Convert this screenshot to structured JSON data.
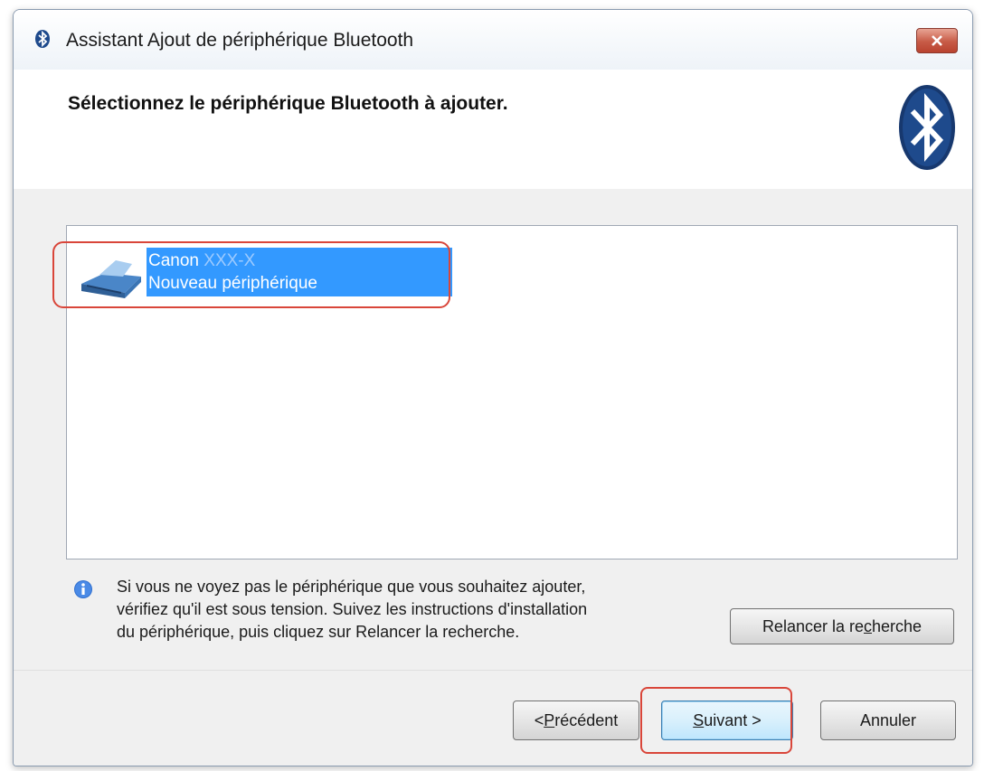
{
  "window": {
    "title": "Assistant Ajout de périphérique Bluetooth",
    "close_icon": "close-icon",
    "title_icon": "bluetooth-icon"
  },
  "header": {
    "title": "Sélectionnez le périphérique Bluetooth à ajouter.",
    "logo": "bluetooth-logo"
  },
  "device_list": {
    "items": [
      {
        "name": "Canon",
        "name_suffix": "XXX-X",
        "status": "Nouveau périphérique",
        "icon": "printer-icon",
        "selected": true
      }
    ]
  },
  "info": {
    "icon": "info-icon",
    "lines": [
      "Si vous ne voyez pas le périphérique que vous souhaitez ajouter,",
      "vérifiez qu'il est sous tension. Suivez les instructions d'installation",
      "du périphérique, puis cliquez sur Relancer la recherche."
    ]
  },
  "buttons": {
    "retry": {
      "pre": "Relancer la re",
      "ul": "c",
      "post": "herche"
    },
    "prev": {
      "pre": "< ",
      "ul": "P",
      "post": "récédent"
    },
    "next": {
      "pre": "",
      "ul": "S",
      "post": "uivant >"
    },
    "cancel": {
      "label": "Annuler"
    }
  },
  "colors": {
    "selection": "#3399ff",
    "annotation": "#d9463a",
    "bluetooth": "#1e4a8c"
  }
}
